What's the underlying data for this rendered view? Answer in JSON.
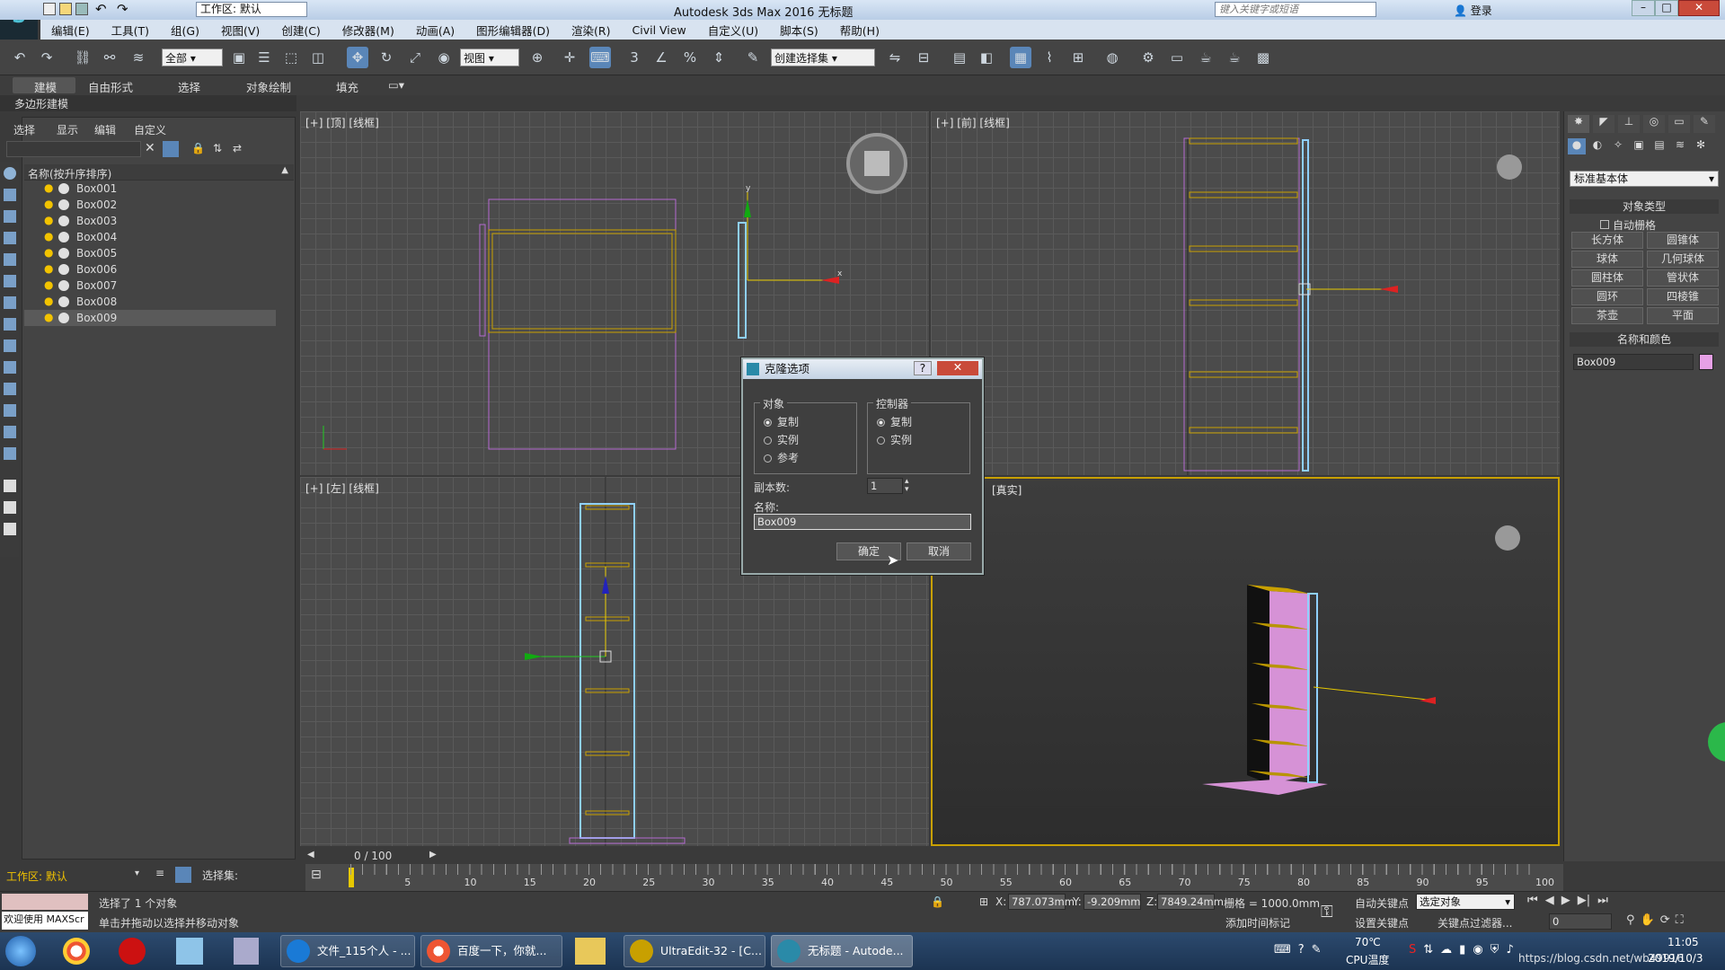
{
  "titlebar": {
    "workspace": "工作区: 默认",
    "title": "Autodesk 3ds Max 2016    无标题",
    "search_placeholder": "键入关键字或短语",
    "login": "登录"
  },
  "menu": [
    "编辑(E)",
    "工具(T)",
    "组(G)",
    "视图(V)",
    "创建(C)",
    "修改器(M)",
    "动画(A)",
    "图形编辑器(D)",
    "渲染(R)",
    "Civil View",
    "自定义(U)",
    "脚本(S)",
    "帮助(H)"
  ],
  "toolbar": {
    "filter": "全部",
    "refcoord": "视图",
    "named_selection": "创建选择集"
  },
  "ribbon": {
    "tabs": [
      "建模",
      "自由形式",
      "选择",
      "对象绘制",
      "填充"
    ],
    "sub": "多边形建模"
  },
  "explorer": {
    "tabs": [
      "选择",
      "显示",
      "编辑",
      "自定义"
    ],
    "header": "名称(按升序排序)",
    "objects": [
      "Box001",
      "Box002",
      "Box003",
      "Box004",
      "Box005",
      "Box006",
      "Box007",
      "Box008",
      "Box009"
    ],
    "selected": "Box009",
    "workspace": "工作区: 默认",
    "selection_set": "选择集:"
  },
  "viewports": {
    "top": "[+] [顶] [线框]",
    "front": "[+] [前] [线框]",
    "left": "[+] [左] [线框]",
    "persp": "[真实]"
  },
  "dialog": {
    "title": "克隆选项",
    "object_group": "对象",
    "controller_group": "控制器",
    "object_opts": [
      "复制",
      "实例",
      "参考"
    ],
    "controller_opts": [
      "复制",
      "实例"
    ],
    "copies_label": "副本数:",
    "copies_value": "1",
    "name_label": "名称:",
    "name_value": "Box009",
    "ok": "确定",
    "cancel": "取消"
  },
  "rightpanel": {
    "dropdown": "标准基本体",
    "object_type": "对象类型",
    "autogrid": "自动栅格",
    "buttons": [
      "长方体",
      "圆锥体",
      "球体",
      "几何球体",
      "圆柱体",
      "管状体",
      "圆环",
      "四棱锥",
      "茶壶",
      "平面"
    ],
    "name_color": "名称和颜色",
    "name_value": "Box009",
    "object_color": "#e6a0e6"
  },
  "timeline": {
    "frame": "0 / 100",
    "ticks": [
      "5",
      "10",
      "15",
      "20",
      "25",
      "30",
      "35",
      "40",
      "45",
      "50",
      "55",
      "60",
      "65",
      "70",
      "75",
      "80",
      "85",
      "90",
      "95",
      "100"
    ]
  },
  "status": {
    "welcome": "欢迎使用 MAXScr",
    "selected": "选择了 1 个对象",
    "hint": "单击并拖动以选择并移动对象",
    "x": "787.073mm",
    "y": "-9.209mm",
    "z": "7849.24mm",
    "grid": "栅格 = 1000.0mm",
    "add_time_tag": "添加时间标记",
    "autokey": "自动关键点",
    "setkey": "设置关键点",
    "selected_object": "选定对象",
    "key_filters": "关键点过滤器...",
    "frame_field": "0"
  },
  "taskbar": {
    "tasks": [
      "文件_115个人 - ...",
      "百度一下，你就...",
      "UltraEdit-32 - [C...",
      "无标题 - Autode..."
    ],
    "temp": "70℃",
    "cpu": "CPU温度",
    "time": "11:05",
    "date": "2019/10/3",
    "watermark": "https://blog.csdn.net/wb49916"
  }
}
